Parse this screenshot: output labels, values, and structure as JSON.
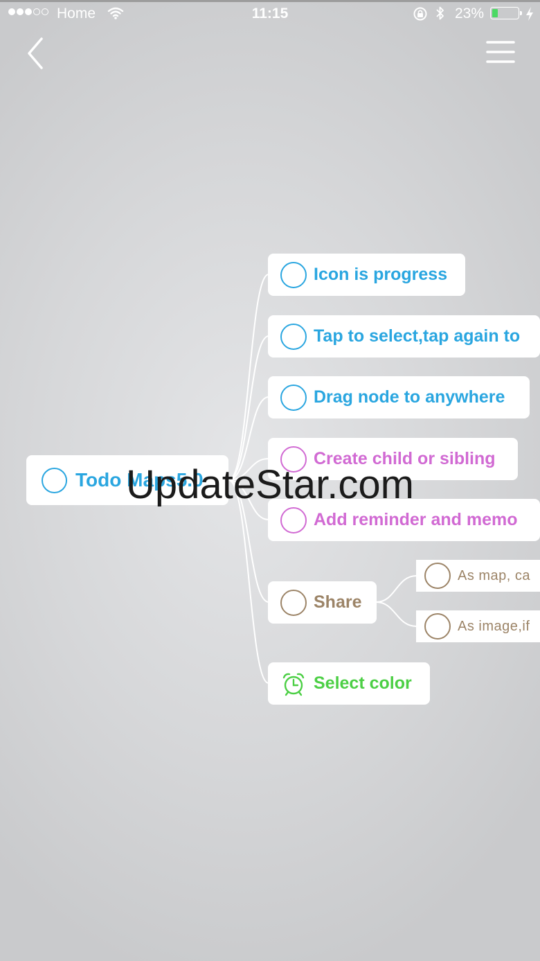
{
  "status_bar": {
    "carrier": "Home",
    "time": "11:15",
    "battery_percent": "23%",
    "battery_level": 0.23,
    "signal_bars_filled": 3,
    "signal_bars_total": 5,
    "battery_fill_color": "#4cd964"
  },
  "nav": {
    "back_icon": "chevron-left-icon",
    "menu_icon": "hamburger-menu-icon"
  },
  "mindmap": {
    "root": {
      "label": "Todo Maps5.0",
      "color": "#2aa6e0",
      "icon": "circle-icon"
    },
    "children": [
      {
        "label": "Icon is progress",
        "color": "#2aa6e0",
        "icon": "circle-icon"
      },
      {
        "label": "Tap to select,tap again to",
        "color": "#2aa6e0",
        "icon": "circle-icon"
      },
      {
        "label": "Drag node to anywhere",
        "color": "#2aa6e0",
        "icon": "circle-icon"
      },
      {
        "label": "Create child or sibling",
        "color": "#d16ad3",
        "icon": "circle-icon"
      },
      {
        "label": "Add reminder and memo",
        "color": "#d16ad3",
        "icon": "circle-icon"
      },
      {
        "label": "Share",
        "color": "#9c8467",
        "icon": "circle-icon",
        "children": [
          {
            "label": "As map, ca",
            "icon": "circle-icon"
          },
          {
            "label": "As image,if",
            "icon": "circle-icon"
          }
        ]
      },
      {
        "label": "Select color",
        "color": "#4ccf45",
        "icon": "alarm-clock-icon"
      }
    ]
  },
  "watermark": "UpdateStar.com"
}
